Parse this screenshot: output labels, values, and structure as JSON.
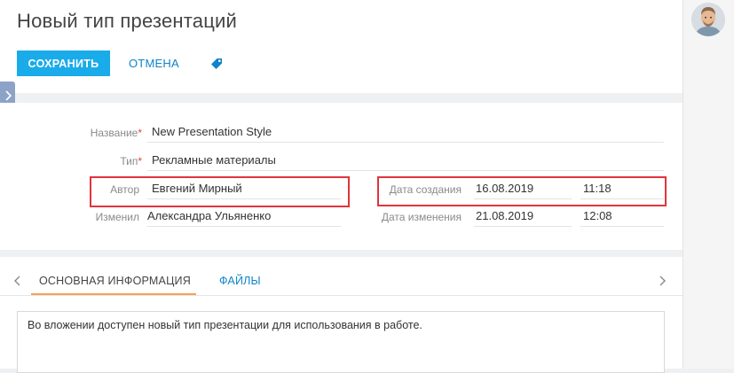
{
  "page": {
    "title": "Новый тип презентаций"
  },
  "toolbar": {
    "save_label": "СОХРАНИТЬ",
    "cancel_label": "ОТМЕНА",
    "tag_icon": "tag-icon"
  },
  "form": {
    "name": {
      "label": "Название",
      "required_mark": "*",
      "value": "New Presentation Style"
    },
    "type": {
      "label": "Тип",
      "required_mark": "*",
      "value": "Рекламные материалы"
    },
    "author": {
      "label": "Автор",
      "value": "Евгений Мирный"
    },
    "modified_by": {
      "label": "Изменил",
      "value": "Александра Ульяненко"
    },
    "created": {
      "label": "Дата создания",
      "date": "16.08.2019",
      "time": "11:18"
    },
    "modified": {
      "label": "Дата изменения",
      "date": "21.08.2019",
      "time": "12:08"
    }
  },
  "tabs": [
    {
      "label": "ОСНОВНАЯ ИНФОРМАЦИЯ",
      "active": true
    },
    {
      "label": "ФАЙЛЫ",
      "active": false
    }
  ],
  "notes": {
    "text": "Во вложении доступен новый тип презентации для использования в работе."
  },
  "colors": {
    "accent": "#1aabea",
    "link": "#0e84c9",
    "tab_underline": "#f5a15c",
    "highlight": "#e1343d",
    "required": "#e2433f"
  }
}
